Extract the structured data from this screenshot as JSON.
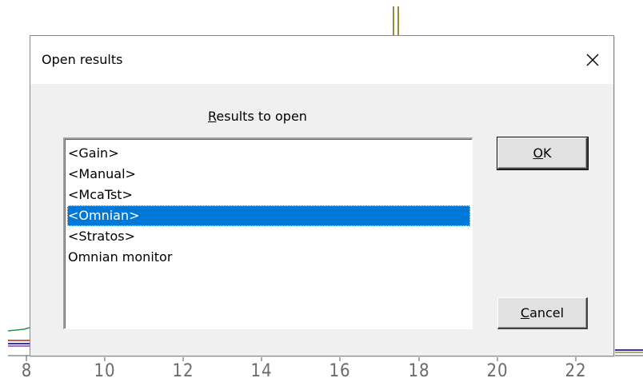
{
  "background": {
    "x_tick_labels": [
      "8",
      "10",
      "12",
      "14",
      "16",
      "18",
      "20",
      "22"
    ]
  },
  "dialog": {
    "title": "Open results",
    "close_icon": "close-icon",
    "list_caption_mnemonic": "R",
    "list_caption_rest": "esults to open",
    "items": [
      {
        "label": "<Gain>",
        "selected": false
      },
      {
        "label": "<Manual>",
        "selected": false
      },
      {
        "label": "<McaTst>",
        "selected": false
      },
      {
        "label": "<Omnian>",
        "selected": true
      },
      {
        "label": "<Stratos>",
        "selected": false
      },
      {
        "label": "Omnian monitor",
        "selected": false
      }
    ],
    "ok_mnemonic": "O",
    "ok_rest": "K",
    "cancel_mnemonic": "C",
    "cancel_rest": "ancel",
    "colors": {
      "selection": "#0078d7",
      "dialog_bg": "#f0f0f0",
      "title_bg": "#ffffff"
    }
  }
}
